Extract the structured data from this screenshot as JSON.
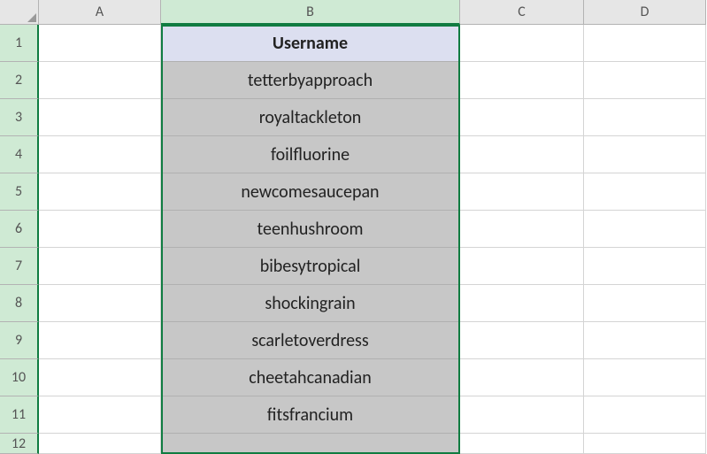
{
  "columns": [
    "A",
    "B",
    "C",
    "D"
  ],
  "selected_column_index": 1,
  "rows": [
    1,
    2,
    3,
    4,
    5,
    6,
    7,
    8,
    9,
    10,
    11
  ],
  "selected_rows_all": true,
  "partial_row": 12,
  "data_column": "B",
  "table": {
    "header": "Username",
    "values": [
      "tetterbyapproach",
      "royaltackleton",
      "foilfluorine",
      "newcomesaucepan",
      "teenhushroom",
      "bibesytropical",
      "shockingrain",
      "scarletoverdress",
      "cheetahcanadian",
      "fitsfrancium"
    ]
  },
  "chart_data": {
    "type": "table",
    "title": "Username",
    "columns": [
      "Username"
    ],
    "rows": [
      [
        "tetterbyapproach"
      ],
      [
        "royaltackleton"
      ],
      [
        "foilfluorine"
      ],
      [
        "newcomesaucepan"
      ],
      [
        "teenhushroom"
      ],
      [
        "bibesytropical"
      ],
      [
        "shockingrain"
      ],
      [
        "scarletoverdress"
      ],
      [
        "cheetahcanadian"
      ],
      [
        "fitsfrancium"
      ]
    ]
  },
  "colors": {
    "selection_border": "#107c41",
    "col_selected_bg": "#cfead4",
    "header_fill": "#dcdff0",
    "sel_fill": "#c7c7c7"
  }
}
